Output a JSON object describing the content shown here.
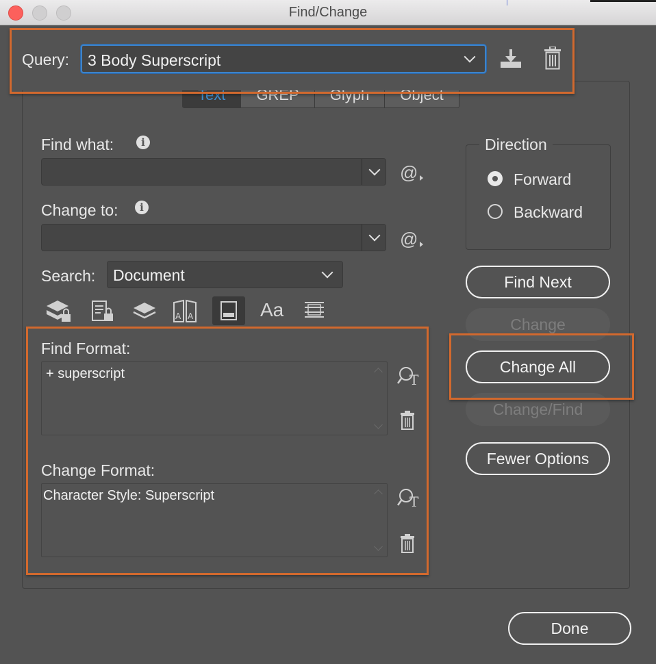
{
  "window": {
    "title": "Find/Change"
  },
  "query": {
    "label": "Query:",
    "value": "3 Body Superscript"
  },
  "tabs": [
    {
      "label": "Text",
      "active": true
    },
    {
      "label": "GREP",
      "active": false
    },
    {
      "label": "Glyph",
      "active": false
    },
    {
      "label": "Object",
      "active": false
    }
  ],
  "find_what": {
    "label": "Find what:",
    "value": ""
  },
  "change_to": {
    "label": "Change to:",
    "value": ""
  },
  "search": {
    "label": "Search:",
    "value": "Document"
  },
  "direction": {
    "label": "Direction",
    "options": [
      "Forward",
      "Backward"
    ],
    "selected": "Forward"
  },
  "buttons": {
    "find_next": "Find Next",
    "change": "Change",
    "change_all": "Change All",
    "change_find": "Change/Find",
    "fewer_options": "Fewer Options",
    "done": "Done"
  },
  "find_format": {
    "label": "Find Format:",
    "value": "+ superscript"
  },
  "change_format": {
    "label": "Change Format:",
    "value": "Character Style: Superscript"
  },
  "option_icons": [
    "locked-layers-icon",
    "locked-stories-icon",
    "hidden-layers-icon",
    "master-pages-icon",
    "footnotes-icon",
    "case-sensitive-icon",
    "whole-word-icon"
  ],
  "case_icon_text": "Aa",
  "colors": {
    "accent_highlight": "#d2692e",
    "selection_blue": "#3e83c9",
    "background": "#535353"
  }
}
